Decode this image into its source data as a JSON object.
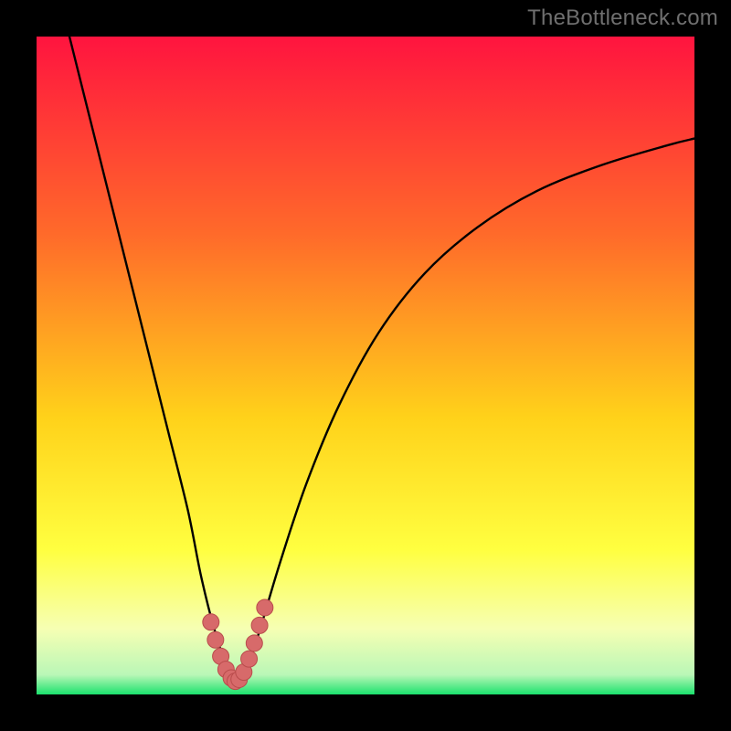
{
  "watermark": "TheBottleneck.com",
  "colors": {
    "frame": "#000000",
    "gradient_top": "#ff143f",
    "gradient_mid1": "#ff6a2a",
    "gradient_mid2": "#ffd21a",
    "gradient_mid3": "#ffff40",
    "gradient_low": "#f6ffb3",
    "gradient_green": "#1be26d",
    "curve": "#000000",
    "marker_fill": "#d76a6a",
    "marker_stroke": "#b94c4c"
  },
  "chart_data": {
    "type": "line",
    "title": "",
    "xlabel": "",
    "ylabel": "",
    "xlim": [
      0,
      100
    ],
    "ylim": [
      0,
      100
    ],
    "series": [
      {
        "name": "bottleneck-curve",
        "x": [
          5,
          8,
          11,
          14,
          17,
          20,
          23,
          25,
          27,
          29,
          30.5,
          32,
          34,
          37,
          41,
          46,
          52,
          59,
          67,
          76,
          86,
          96,
          100
        ],
        "y": [
          100,
          88,
          76,
          64,
          52,
          40,
          28,
          18,
          10,
          4,
          2,
          4,
          10,
          20,
          32,
          44,
          55,
          64,
          71,
          76.5,
          80.5,
          83.5,
          84.5
        ]
      }
    ],
    "markers": {
      "name": "valley-markers",
      "x": [
        26.5,
        27.2,
        28.0,
        28.8,
        29.6,
        30.2,
        30.8,
        31.5,
        32.3,
        33.1,
        33.9,
        34.7
      ],
      "y": [
        11.0,
        8.3,
        5.8,
        3.8,
        2.5,
        2.0,
        2.3,
        3.4,
        5.4,
        7.8,
        10.5,
        13.2
      ]
    }
  }
}
